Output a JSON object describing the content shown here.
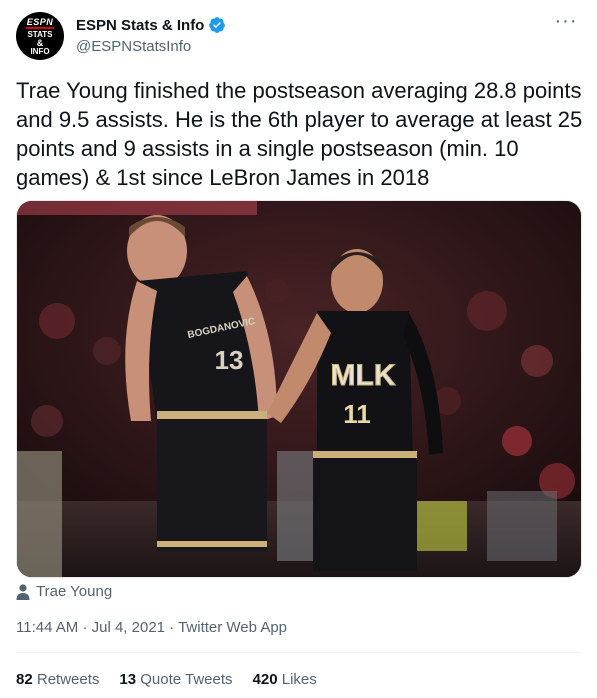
{
  "header": {
    "avatar_text": {
      "logo": "ESPN",
      "line1": "STATS",
      "line2": "&",
      "line3": "INFO"
    },
    "display_name": "ESPN Stats & Info",
    "handle": "@ESPNStatsInfo",
    "more_label": "···",
    "verified_color": "#1d9bf0"
  },
  "tweet": {
    "text": "Trae Young finished the postseason averaging 28.8 points and 9.5 assists. He is the 6th player to average at least 25 points and 9 assists in a single postseason (min. 10 games) & 1st since LeBron James in 2018",
    "media": {
      "left_jersey_name": "BOGDANOVIC",
      "left_jersey_number": "13",
      "right_jersey_text": "MLK",
      "right_jersey_number": "11"
    },
    "tagged_person": "Trae Young",
    "time": "11:44 AM",
    "separator": "·",
    "date": "Jul 4, 2021",
    "source": "Twitter Web App"
  },
  "stats": {
    "retweets_count": "82",
    "retweets_label": "Retweets",
    "quote_count": "13",
    "quote_label": "Quote Tweets",
    "likes_count": "420",
    "likes_label": "Likes"
  }
}
